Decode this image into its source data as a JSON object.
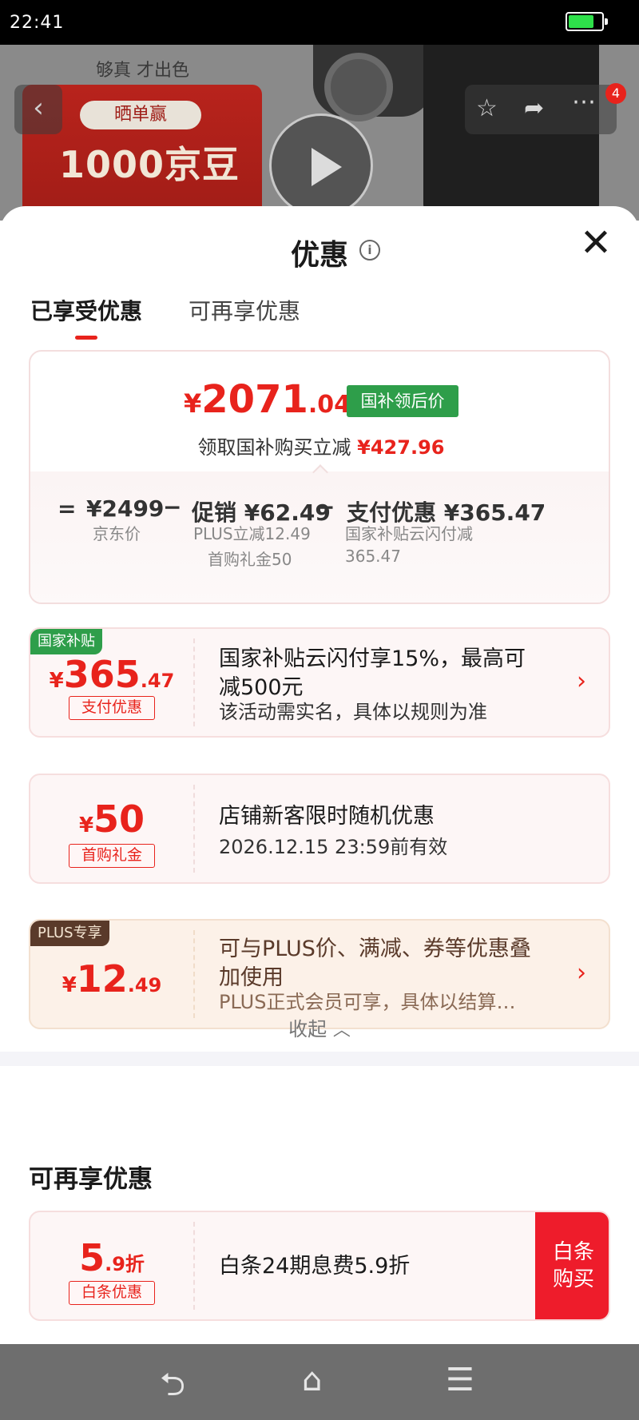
{
  "status_bar": {
    "time": "22:41",
    "battery_level": 0.78
  },
  "backdrop": {
    "slogan": "够真 才出色",
    "promo_pill": "晒单赢",
    "promo_big": "1000京豆",
    "badge_count": "4"
  },
  "sheet": {
    "title": "优惠",
    "tabs": [
      {
        "label": "已享受优惠",
        "active": true
      },
      {
        "label": "可再享优惠",
        "active": false
      }
    ]
  },
  "summary": {
    "currency": "¥",
    "price_integer": "2071",
    "price_decimal": ".04",
    "price_tag": "国补领后价",
    "reduce_text": "领取国补购买立减",
    "reduce_amount": "¥427.96",
    "breakdown": {
      "equals": "=",
      "minus": "−",
      "jd_price": "¥2499",
      "jd_price_label": "京东价",
      "promo_value": "促销 ¥62.49",
      "promo_note_1": "PLUS立减12.49",
      "promo_note_2": "首购礼金50",
      "pay_value": "支付优惠 ¥365.47",
      "pay_note_1": "国家补贴云闪付减",
      "pay_note_2": "365.47"
    }
  },
  "coupons": [
    {
      "corner_tag": "国家补贴",
      "currency": "¥",
      "amount_int": "365",
      "amount_dec": ".47",
      "type_tag": "支付优惠",
      "title": "国家补贴云闪付享15%，最高可减500元",
      "subtitle": "该活动需实名，具体以规则为准"
    },
    {
      "currency": "¥",
      "amount_int": "50",
      "type_tag": "首购礼金",
      "title": "店铺新客限时随机优惠",
      "subtitle": "2026.12.15 23:59前有效"
    },
    {
      "corner_tag": "PLUS专享",
      "currency": "¥",
      "amount_int": "12",
      "amount_dec": ".49",
      "title": "可与PLUS价、满减、券等优惠叠加使用",
      "subtitle": "PLUS正式会员可享，具体以结算…"
    }
  ],
  "collapse_label": "收起",
  "more_section": {
    "title": "可再享优惠",
    "coupon": {
      "amount_int": "5",
      "amount_dec": ".9折",
      "type_tag": "白条优惠",
      "title": "白条24期息费5.9折",
      "button_line1": "白条",
      "button_line2": "购买"
    }
  },
  "colors": {
    "accent_red": "#e8231c",
    "subsidy_green": "#2e9e4a",
    "plus_brown": "#5a3a2a",
    "buy_button_red": "#ee1c2b"
  },
  "icons": {
    "back": "back-arrow-icon",
    "favorite": "star-icon",
    "share": "share-icon",
    "more": "more-dots-icon",
    "play": "play-icon",
    "info": "info-icon",
    "close": "close-icon",
    "chevron": "chevron-right-icon",
    "collapse": "chevron-up-icon",
    "nav_back": "nav-back-icon",
    "nav_home": "nav-home-icon",
    "nav_menu": "nav-menu-icon"
  }
}
